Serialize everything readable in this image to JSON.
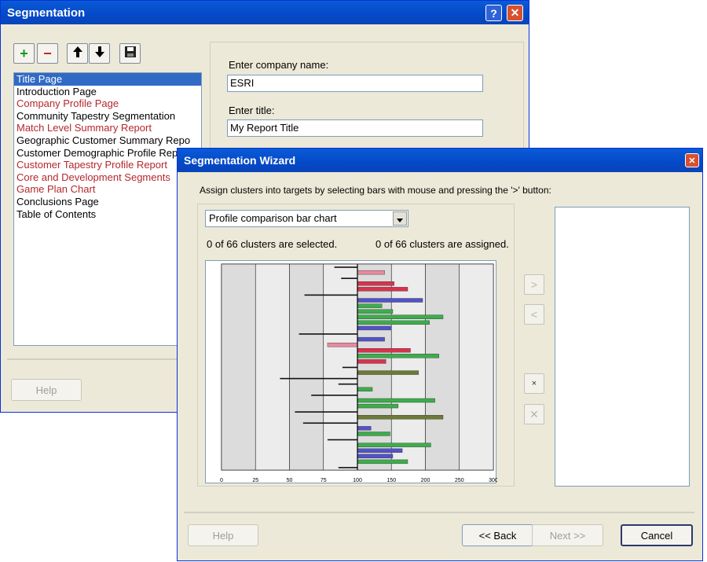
{
  "segmentation": {
    "title": "Segmentation",
    "help_btn": "?",
    "close_btn": "✕",
    "toolbar": {
      "add": "+",
      "remove": "−",
      "up": "🡑",
      "down": "🡓",
      "save": "💾"
    },
    "pages": [
      {
        "label": "Title Page",
        "selected": true,
        "color": "normal"
      },
      {
        "label": "Introduction Page",
        "color": "normal"
      },
      {
        "label": "Company Profile Page",
        "color": "red"
      },
      {
        "label": "Community  Tapestry  Segmentation",
        "color": "normal"
      },
      {
        "label": "Match Level Summary Report",
        "color": "red"
      },
      {
        "label": "Geographic  Customer  Summary  Repo",
        "color": "normal"
      },
      {
        "label": "Customer  Demographic  Profile  Rep",
        "color": "normal"
      },
      {
        "label": "Customer Tapestry Profile Report",
        "color": "red"
      },
      {
        "label": "Core  and  Development  Segments",
        "color": "red"
      },
      {
        "label": "Game Plan Chart",
        "color": "red"
      },
      {
        "label": "Conclusions Page",
        "color": "normal"
      },
      {
        "label": "Table of Contents",
        "color": "normal"
      }
    ],
    "company_label": "Enter company name:",
    "company_value": "ESRI",
    "title_label": "Enter title:",
    "title_value": "My Report Title",
    "help_button": "Help"
  },
  "wizard": {
    "title": "Segmentation Wizard",
    "close_btn": "✕",
    "instruction": "Assign clusters into targets by selecting bars with mouse and pressing the '>' button:",
    "chart_select": "Profile comparison bar chart",
    "selected_status": "0 of 66 clusters are selected.",
    "assigned_status": "0 of 66 clusters are assigned.",
    "assign_btn": ">",
    "unassign_btn": "<",
    "small_btn": "×",
    "clear_btn": "✕",
    "help_button": "Help",
    "back_button": "<< Back",
    "next_button": "Next >>",
    "cancel_button": "Cancel"
  },
  "chart_data": {
    "type": "bar",
    "orientation": "horizontal",
    "baseline": 100,
    "xlim": [
      0,
      200
    ],
    "x_ticks": [
      "0",
      "25",
      "50",
      "75",
      "100",
      "150",
      "200",
      "250",
      "300"
    ],
    "grid": true,
    "colors": {
      "dark": "#111111",
      "pink": "#e88aa0",
      "red": "#d8324c",
      "blue": "#5252c8",
      "green": "#3cad4c",
      "olive": "#6b7a35"
    },
    "values": [
      {
        "v": 83,
        "c": "dark"
      },
      {
        "v": 120,
        "c": "pink"
      },
      {
        "v": 88,
        "c": "dark"
      },
      {
        "v": 127,
        "c": "red"
      },
      {
        "v": 137,
        "c": "red"
      },
      {
        "v": 61,
        "c": "dark"
      },
      {
        "v": 148,
        "c": "blue"
      },
      {
        "v": 118,
        "c": "green"
      },
      {
        "v": 126,
        "c": "green"
      },
      {
        "v": 163,
        "c": "green"
      },
      {
        "v": 153,
        "c": "green"
      },
      {
        "v": 125,
        "c": "blue"
      },
      {
        "v": 57,
        "c": "dark"
      },
      {
        "v": 120,
        "c": "blue"
      },
      {
        "v": 78,
        "c": "pink"
      },
      {
        "v": 139,
        "c": "red"
      },
      {
        "v": 160,
        "c": "green"
      },
      {
        "v": 121,
        "c": "red"
      },
      {
        "v": 89,
        "c": "dark"
      },
      {
        "v": 145,
        "c": "olive"
      },
      {
        "v": 43,
        "c": "dark"
      },
      {
        "v": 86,
        "c": "dark"
      },
      {
        "v": 111,
        "c": "green"
      },
      {
        "v": 66,
        "c": "dark"
      },
      {
        "v": 157,
        "c": "green"
      },
      {
        "v": 130,
        "c": "green"
      },
      {
        "v": 54,
        "c": "dark"
      },
      {
        "v": 163,
        "c": "olive"
      },
      {
        "v": 60,
        "c": "dark"
      },
      {
        "v": 110,
        "c": "blue"
      },
      {
        "v": 124,
        "c": "green"
      },
      {
        "v": 78,
        "c": "dark"
      },
      {
        "v": 154,
        "c": "green"
      },
      {
        "v": 133,
        "c": "blue"
      },
      {
        "v": 126,
        "c": "blue"
      },
      {
        "v": 137,
        "c": "green"
      },
      {
        "v": 86,
        "c": "dark"
      }
    ]
  }
}
